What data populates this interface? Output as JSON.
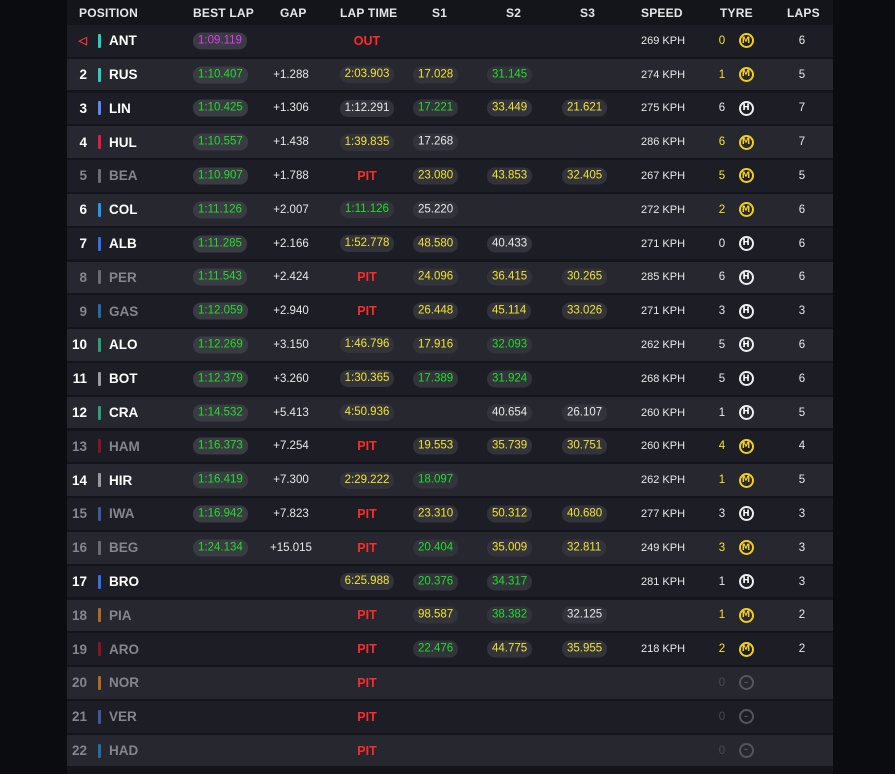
{
  "colors": {
    "best_chip_bg": "#3a3b43",
    "green": "#22dd2a",
    "yellow": "#f2e42f",
    "purple": "#dd3cf2",
    "red": "#ff2a2a",
    "medium_tyre": "#f0cf1c"
  },
  "header": {
    "position": "POSITION",
    "best_lap": "BEST LAP",
    "gap": "GAP",
    "lap_time": "LAP TIME",
    "s1": "S1",
    "s2": "S2",
    "s3": "S3",
    "speed": "SPEED",
    "tyre": "TYRE",
    "laps": "LAPS"
  },
  "rows": [
    {
      "pos": "",
      "pos_icon": "leader-marker-icon",
      "team": "#1fd3c0",
      "code": "ANT",
      "dim": false,
      "best": "1:09.119",
      "best_color": "purple",
      "gap": "",
      "lap": "",
      "lap_color": "",
      "status": "OUT",
      "s1": "",
      "s1c": "",
      "s2": "",
      "s2c": "",
      "s3": "",
      "s3c": "",
      "speed": "269 KPH",
      "tyre_laps": "0",
      "tyre_laps_color": "yellow",
      "tyre": "M",
      "tyre_type": "med",
      "laps": "6"
    },
    {
      "pos": "2",
      "team": "#1fd3c0",
      "code": "RUS",
      "dim": false,
      "best": "1:10.407",
      "best_color": "green",
      "gap": "+1.288",
      "lap": "2:03.903",
      "lap_color": "yellow",
      "status": "",
      "s1": "17.028",
      "s1c": "yellow",
      "s2": "31.145",
      "s2c": "green",
      "s3": "",
      "s3c": "",
      "speed": "274 KPH",
      "tyre_laps": "1",
      "tyre_laps_color": "yellow",
      "tyre": "M",
      "tyre_type": "med",
      "laps": "5"
    },
    {
      "pos": "3",
      "team": "#5b86ff",
      "code": "LIN",
      "dim": false,
      "best": "1:10.425",
      "best_color": "green",
      "gap": "+1.306",
      "lap": "1:12.291",
      "lap_color": "white",
      "status": "",
      "s1": "17.221",
      "s1c": "green",
      "s2": "33.449",
      "s2c": "yellow",
      "s3": "21.621",
      "s3c": "yellow",
      "speed": "275 KPH",
      "tyre_laps": "6",
      "tyre_laps_color": "white",
      "tyre": "H",
      "tyre_type": "hard",
      "laps": "7"
    },
    {
      "pos": "4",
      "team": "#e8193e",
      "code": "HUL",
      "dim": false,
      "best": "1:10.557",
      "best_color": "green",
      "gap": "+1.438",
      "lap": "1:39.835",
      "lap_color": "yellow",
      "status": "",
      "s1": "17.268",
      "s1c": "white",
      "s2": "",
      "s2c": "",
      "s3": "",
      "s3c": "",
      "speed": "286 KPH",
      "tyre_laps": "6",
      "tyre_laps_color": "yellow",
      "tyre": "M",
      "tyre_type": "med",
      "laps": "7"
    },
    {
      "pos": "5",
      "team": "#6b6c72",
      "code": "BEA",
      "dim": true,
      "best": "1:10.907",
      "best_color": "green",
      "gap": "+1.788",
      "lap": "",
      "lap_color": "",
      "status": "PIT",
      "s1": "23.080",
      "s1c": "yellow",
      "s2": "43.853",
      "s2c": "yellow",
      "s3": "32.405",
      "s3c": "yellow",
      "speed": "267 KPH",
      "tyre_laps": "5",
      "tyre_laps_color": "yellow",
      "tyre": "M",
      "tyre_type": "med",
      "laps": "5"
    },
    {
      "pos": "6",
      "team": "#1a9bf0",
      "code": "COL",
      "dim": false,
      "best": "1:11.126",
      "best_color": "green",
      "gap": "+2.007",
      "lap": "1:11.126",
      "lap_color": "green",
      "status": "",
      "s1": "25.220",
      "s1c": "white",
      "s2": "",
      "s2c": "",
      "s3": "",
      "s3c": "",
      "speed": "272 KPH",
      "tyre_laps": "2",
      "tyre_laps_color": "yellow",
      "tyre": "M",
      "tyre_type": "med",
      "laps": "6"
    },
    {
      "pos": "7",
      "team": "#2f6ff0",
      "code": "ALB",
      "dim": false,
      "best": "1:11.285",
      "best_color": "green",
      "gap": "+2.166",
      "lap": "1:52.778",
      "lap_color": "yellow",
      "status": "",
      "s1": "48.580",
      "s1c": "yellow",
      "s2": "40.433",
      "s2c": "white",
      "s3": "",
      "s3c": "",
      "speed": "271 KPH",
      "tyre_laps": "0",
      "tyre_laps_color": "white",
      "tyre": "H",
      "tyre_type": "hard",
      "laps": "6"
    },
    {
      "pos": "8",
      "team": "#6b6c72",
      "code": "PER",
      "dim": true,
      "best": "1:11.543",
      "best_color": "green",
      "gap": "+2.424",
      "lap": "",
      "lap_color": "",
      "status": "PIT",
      "s1": "24.096",
      "s1c": "yellow",
      "s2": "36.415",
      "s2c": "yellow",
      "s3": "30.265",
      "s3c": "yellow",
      "speed": "285 KPH",
      "tyre_laps": "6",
      "tyre_laps_color": "white",
      "tyre": "H",
      "tyre_type": "hard",
      "laps": "6"
    },
    {
      "pos": "9",
      "team": "#1e6fa8",
      "code": "GAS",
      "dim": true,
      "best": "1:12.059",
      "best_color": "green",
      "gap": "+2.940",
      "lap": "",
      "lap_color": "",
      "status": "PIT",
      "s1": "26.448",
      "s1c": "yellow",
      "s2": "45.114",
      "s2c": "yellow",
      "s3": "33.026",
      "s3c": "yellow",
      "speed": "271 KPH",
      "tyre_laps": "3",
      "tyre_laps_color": "white",
      "tyre": "H",
      "tyre_type": "hard",
      "laps": "3"
    },
    {
      "pos": "10",
      "team": "#22a37a",
      "code": "ALO",
      "dim": false,
      "best": "1:12.269",
      "best_color": "green",
      "gap": "+3.150",
      "lap": "1:46.796",
      "lap_color": "yellow",
      "status": "",
      "s1": "17.916",
      "s1c": "yellow",
      "s2": "32.093",
      "s2c": "green",
      "s3": "",
      "s3c": "",
      "speed": "262 KPH",
      "tyre_laps": "5",
      "tyre_laps_color": "white",
      "tyre": "H",
      "tyre_type": "hard",
      "laps": "6"
    },
    {
      "pos": "11",
      "team": "#9a9ba0",
      "code": "BOT",
      "dim": false,
      "best": "1:12.379",
      "best_color": "green",
      "gap": "+3.260",
      "lap": "1:30.365",
      "lap_color": "yellow",
      "status": "",
      "s1": "17.389",
      "s1c": "green",
      "s2": "31.924",
      "s2c": "green",
      "s3": "",
      "s3c": "",
      "speed": "268 KPH",
      "tyre_laps": "5",
      "tyre_laps_color": "white",
      "tyre": "H",
      "tyre_type": "hard",
      "laps": "6"
    },
    {
      "pos": "12",
      "team": "#22a37a",
      "code": "CRA",
      "dim": false,
      "best": "1:14.532",
      "best_color": "green",
      "gap": "+5.413",
      "lap": "4:50.936",
      "lap_color": "yellow",
      "status": "",
      "s1": "",
      "s1c": "",
      "s2": "40.654",
      "s2c": "white",
      "s3": "26.107",
      "s3c": "white",
      "speed": "260 KPH",
      "tyre_laps": "1",
      "tyre_laps_color": "white",
      "tyre": "H",
      "tyre_type": "hard",
      "laps": "5"
    },
    {
      "pos": "13",
      "team": "#8a1426",
      "code": "HAM",
      "dim": true,
      "best": "1:16.373",
      "best_color": "green",
      "gap": "+7.254",
      "lap": "",
      "lap_color": "",
      "status": "PIT",
      "s1": "19.553",
      "s1c": "yellow",
      "s2": "35.739",
      "s2c": "yellow",
      "s3": "30.751",
      "s3c": "yellow",
      "speed": "260 KPH",
      "tyre_laps": "4",
      "tyre_laps_color": "yellow",
      "tyre": "M",
      "tyre_type": "med",
      "laps": "4"
    },
    {
      "pos": "14",
      "team": "#9a9ba0",
      "code": "HIR",
      "dim": false,
      "best": "1:16.419",
      "best_color": "green",
      "gap": "+7.300",
      "lap": "2:29.222",
      "lap_color": "yellow",
      "status": "",
      "s1": "18.097",
      "s1c": "green",
      "s2": "",
      "s2c": "",
      "s3": "",
      "s3c": "",
      "speed": "262 KPH",
      "tyre_laps": "1",
      "tyre_laps_color": "yellow",
      "tyre": "M",
      "tyre_type": "med",
      "laps": "5"
    },
    {
      "pos": "15",
      "team": "#3a5aa0",
      "code": "IWA",
      "dim": true,
      "best": "1:16.942",
      "best_color": "green",
      "gap": "+7.823",
      "lap": "",
      "lap_color": "",
      "status": "PIT",
      "s1": "23.310",
      "s1c": "yellow",
      "s2": "50.312",
      "s2c": "yellow",
      "s3": "40.680",
      "s3c": "yellow",
      "speed": "277 KPH",
      "tyre_laps": "3",
      "tyre_laps_color": "white",
      "tyre": "H",
      "tyre_type": "hard",
      "laps": "3"
    },
    {
      "pos": "16",
      "team": "#6b6c72",
      "code": "BEG",
      "dim": true,
      "best": "1:24.134",
      "best_color": "green",
      "gap": "+15.015",
      "lap": "",
      "lap_color": "",
      "status": "PIT",
      "s1": "20.404",
      "s1c": "green",
      "s2": "35.009",
      "s2c": "yellow",
      "s3": "32.811",
      "s3c": "yellow",
      "speed": "249 KPH",
      "tyre_laps": "3",
      "tyre_laps_color": "yellow",
      "tyre": "M",
      "tyre_type": "med",
      "laps": "3"
    },
    {
      "pos": "17",
      "team": "#2f6ff0",
      "code": "BRO",
      "dim": false,
      "best": "",
      "best_color": "",
      "gap": "",
      "lap": "6:25.988",
      "lap_color": "yellow",
      "status": "",
      "s1": "20.376",
      "s1c": "green",
      "s2": "34.317",
      "s2c": "green",
      "s3": "",
      "s3c": "",
      "speed": "281 KPH",
      "tyre_laps": "1",
      "tyre_laps_color": "white",
      "tyre": "H",
      "tyre_type": "hard",
      "laps": "3"
    },
    {
      "pos": "18",
      "team": "#b06a1e",
      "code": "PIA",
      "dim": true,
      "best": "",
      "best_color": "",
      "gap": "",
      "lap": "",
      "lap_color": "",
      "status": "PIT",
      "s1": "98.587",
      "s1c": "yellow",
      "s2": "38.382",
      "s2c": "green",
      "s3": "32.125",
      "s3c": "white",
      "speed": "",
      "tyre_laps": "1",
      "tyre_laps_color": "yellow",
      "tyre": "M",
      "tyre_type": "med",
      "laps": "2"
    },
    {
      "pos": "19",
      "team": "#8a1426",
      "code": "ARO",
      "dim": true,
      "best": "",
      "best_color": "",
      "gap": "",
      "lap": "",
      "lap_color": "",
      "status": "PIT",
      "s1": "22.476",
      "s1c": "green",
      "s2": "44.775",
      "s2c": "yellow",
      "s3": "35.955",
      "s3c": "yellow",
      "speed": "218 KPH",
      "tyre_laps": "2",
      "tyre_laps_color": "yellow",
      "tyre": "M",
      "tyre_type": "med",
      "laps": "2"
    },
    {
      "pos": "20",
      "team": "#b06a1e",
      "code": "NOR",
      "dim": true,
      "best": "",
      "best_color": "",
      "gap": "",
      "lap": "",
      "lap_color": "",
      "status": "PIT",
      "s1": "",
      "s1c": "",
      "s2": "",
      "s2c": "",
      "s3": "",
      "s3c": "",
      "speed": "",
      "tyre_laps": "0",
      "tyre_laps_color": "dimmed",
      "tyre": "–",
      "tyre_type": "unk",
      "laps": ""
    },
    {
      "pos": "21",
      "team": "#3a5aa0",
      "code": "VER",
      "dim": true,
      "best": "",
      "best_color": "",
      "gap": "",
      "lap": "",
      "lap_color": "",
      "status": "PIT",
      "s1": "",
      "s1c": "",
      "s2": "",
      "s2c": "",
      "s3": "",
      "s3c": "",
      "speed": "",
      "tyre_laps": "0",
      "tyre_laps_color": "dimmed",
      "tyre": "–",
      "tyre_type": "unk",
      "laps": ""
    },
    {
      "pos": "22",
      "team": "#1e6fa8",
      "code": "HAD",
      "dim": true,
      "best": "",
      "best_color": "",
      "gap": "",
      "lap": "",
      "lap_color": "",
      "status": "PIT",
      "s1": "",
      "s1c": "",
      "s2": "",
      "s2c": "",
      "s3": "",
      "s3c": "",
      "speed": "",
      "tyre_laps": "0",
      "tyre_laps_color": "dimmed",
      "tyre": "–",
      "tyre_type": "unk",
      "laps": ""
    }
  ]
}
